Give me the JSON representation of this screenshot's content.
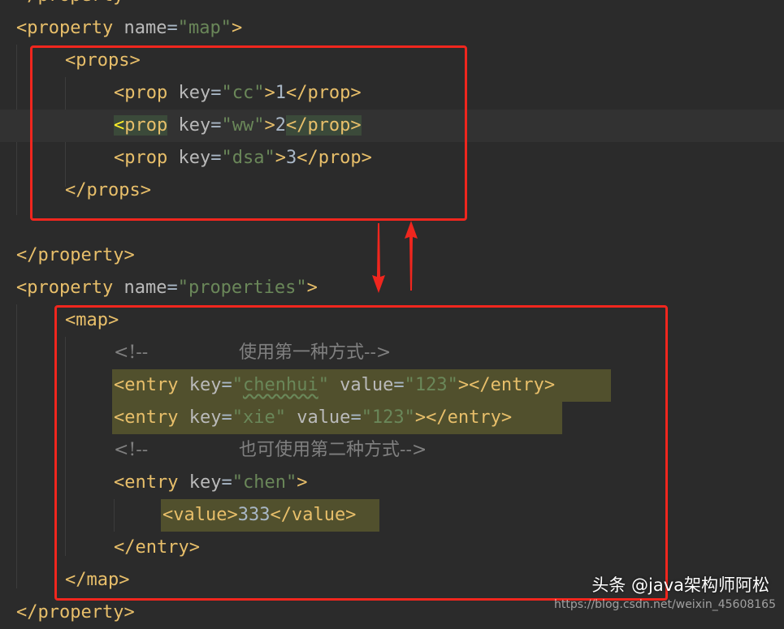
{
  "lines": [
    {
      "parts": [
        {
          "t": "</property>",
          "c": "tag"
        }
      ]
    },
    {
      "parts": [
        {
          "t": "<property",
          "c": "tag"
        },
        {
          "t": " name",
          "c": "attr"
        },
        {
          "t": "=",
          "c": "eq"
        },
        {
          "t": "\"map\"",
          "c": "val"
        },
        {
          "t": ">",
          "c": "tag"
        }
      ]
    },
    {
      "parts": [
        {
          "t": "<props>",
          "c": "tag"
        }
      ]
    },
    {
      "parts": [
        {
          "t": "<prop",
          "c": "tag"
        },
        {
          "t": " key",
          "c": "attr"
        },
        {
          "t": "=",
          "c": "eq"
        },
        {
          "t": "\"cc\"",
          "c": "val"
        },
        {
          "t": ">",
          "c": "tag"
        },
        {
          "t": "1",
          "c": "txt"
        },
        {
          "t": "</prop>",
          "c": "tag"
        }
      ]
    },
    {
      "parts": [
        {
          "t": "<",
          "c": "tag-bright hl"
        },
        {
          "t": "prop",
          "c": "tag hl"
        },
        {
          "t": " key",
          "c": "attr"
        },
        {
          "t": "=",
          "c": "eq"
        },
        {
          "t": "\"ww\"",
          "c": "val"
        },
        {
          "t": ">",
          "c": "tag"
        },
        {
          "t": "2",
          "c": "txt"
        },
        {
          "t": "</prop>",
          "c": "tag hl"
        }
      ]
    },
    {
      "parts": [
        {
          "t": "<prop",
          "c": "tag"
        },
        {
          "t": " key",
          "c": "attr"
        },
        {
          "t": "=",
          "c": "eq"
        },
        {
          "t": "\"dsa\"",
          "c": "val"
        },
        {
          "t": ">",
          "c": "tag"
        },
        {
          "t": "3",
          "c": "txt"
        },
        {
          "t": "</prop>",
          "c": "tag"
        }
      ]
    },
    {
      "parts": [
        {
          "t": "</props>",
          "c": "tag"
        }
      ]
    },
    {
      "parts": []
    },
    {
      "parts": [
        {
          "t": "</property>",
          "c": "tag"
        }
      ]
    },
    {
      "parts": [
        {
          "t": "<property",
          "c": "tag"
        },
        {
          "t": " name",
          "c": "attr"
        },
        {
          "t": "=",
          "c": "eq"
        },
        {
          "t": "\"properties\"",
          "c": "val"
        },
        {
          "t": ">",
          "c": "tag"
        }
      ]
    },
    {
      "parts": [
        {
          "t": "<map>",
          "c": "tag"
        }
      ]
    },
    {
      "parts": [
        {
          "t": "<!--",
          "c": "cmt"
        },
        {
          "t": "                使用第一种方式-->",
          "c": "cmt"
        }
      ]
    },
    {
      "parts": [
        {
          "t": "<entry",
          "c": "tag"
        },
        {
          "t": " key",
          "c": "attr"
        },
        {
          "t": "=",
          "c": "eq"
        },
        {
          "t": "\"",
          "c": "val"
        },
        {
          "t": "chenhui",
          "c": "val squiggle"
        },
        {
          "t": "\"",
          "c": "val"
        },
        {
          "t": " value",
          "c": "attr"
        },
        {
          "t": "=",
          "c": "eq"
        },
        {
          "t": "\"123\"",
          "c": "val"
        },
        {
          "t": "></entry>",
          "c": "tag"
        }
      ]
    },
    {
      "parts": [
        {
          "t": "<entry",
          "c": "tag"
        },
        {
          "t": " key",
          "c": "attr"
        },
        {
          "t": "=",
          "c": "eq"
        },
        {
          "t": "\"xie\"",
          "c": "val"
        },
        {
          "t": " value",
          "c": "attr"
        },
        {
          "t": "=",
          "c": "eq"
        },
        {
          "t": "\"123\"",
          "c": "val"
        },
        {
          "t": "></entry>",
          "c": "tag"
        }
      ]
    },
    {
      "parts": [
        {
          "t": "<!--",
          "c": "cmt"
        },
        {
          "t": "                也可使用第二种方式-->",
          "c": "cmt"
        }
      ]
    },
    {
      "parts": [
        {
          "t": "<entry",
          "c": "tag"
        },
        {
          "t": " key",
          "c": "attr"
        },
        {
          "t": "=",
          "c": "eq"
        },
        {
          "t": "\"chen\"",
          "c": "val"
        },
        {
          "t": ">",
          "c": "tag"
        }
      ]
    },
    {
      "parts": [
        {
          "t": "<value>",
          "c": "tag"
        },
        {
          "t": "333",
          "c": "txt"
        },
        {
          "t": "</value>",
          "c": "tag"
        }
      ]
    },
    {
      "parts": [
        {
          "t": "</entry>",
          "c": "tag"
        }
      ]
    },
    {
      "parts": [
        {
          "t": "</map>",
          "c": "tag"
        }
      ]
    },
    {
      "parts": [
        {
          "t": "</property>",
          "c": "tag"
        }
      ]
    }
  ],
  "watermark": {
    "brand": "头条 @java架构师阿松",
    "url": "https://blog.csdn.net/weixin_45608165"
  },
  "colors": {
    "annotation_red": "#f0261e",
    "editor_bg": "#2b2b2b"
  }
}
